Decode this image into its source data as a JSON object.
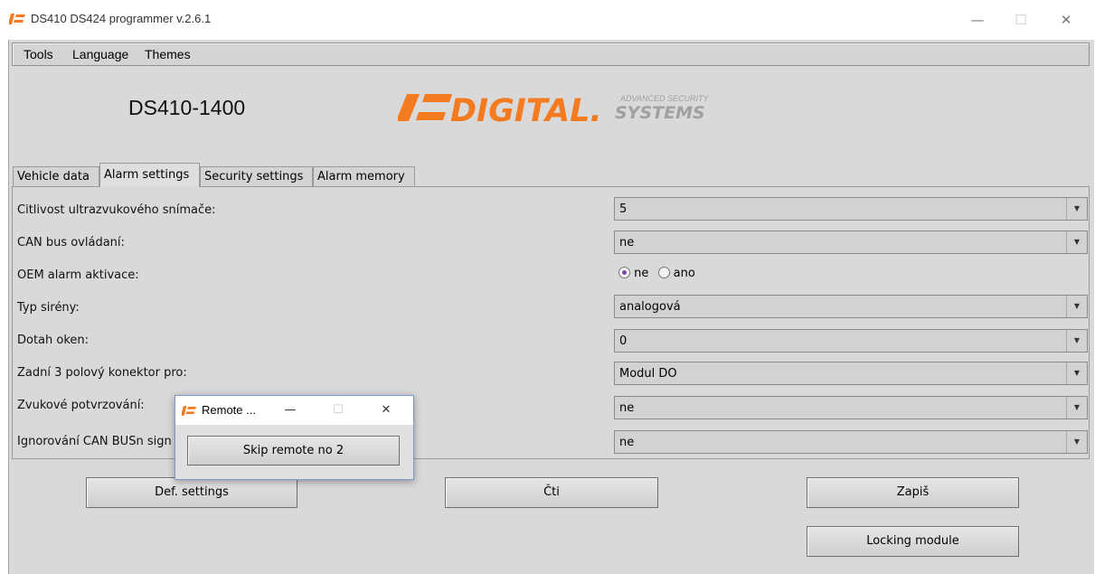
{
  "window": {
    "title": "DS410 DS424 programmer v.2.6.1",
    "min_glyph": "—",
    "max_glyph": "☐",
    "close_glyph": "✕"
  },
  "menu": [
    "Tools",
    "Language",
    "Themes"
  ],
  "device_model": "DS410-1400",
  "logo": {
    "main": "DIGITAL.",
    "tag_top": "ADVANCED SECURITY",
    "tag_bottom": "SYSTEMS",
    "colors": {
      "orange": "#f47b20",
      "gray": "#a0a0a0"
    }
  },
  "tabs": [
    {
      "label": "Vehicle data",
      "active": false
    },
    {
      "label": "Alarm settings",
      "active": true
    },
    {
      "label": "Security settings",
      "active": false
    },
    {
      "label": "Alarm memory",
      "active": false
    }
  ],
  "settings": [
    {
      "label": "Citlivost ultrazvukového snímače:",
      "type": "select",
      "value": "5"
    },
    {
      "label": "CAN bus ovládaní:",
      "type": "select",
      "value": "ne"
    },
    {
      "label": "OEM alarm aktivace:",
      "type": "radio",
      "options": [
        "ne",
        "ano"
      ],
      "selected": "ne"
    },
    {
      "label": "Typ sirény:",
      "type": "select",
      "value": "analogová"
    },
    {
      "label": "Dotah oken:",
      "type": "select",
      "value": "0"
    },
    {
      "label": "Zadní 3 polový konektor pro:",
      "type": "select",
      "value": "Modul DO"
    },
    {
      "label": "Zvukové potvrzování:",
      "type": "select",
      "value": "ne"
    },
    {
      "label": "Ignorování CAN BUSn sign",
      "type": "select",
      "value": "ne"
    }
  ],
  "buttons": {
    "defaults": "Def. settings",
    "read": "Čti",
    "write": "Zapiš",
    "locking": "Locking module"
  },
  "popup": {
    "title": "Remote ...",
    "button": "Skip remote no 2"
  }
}
